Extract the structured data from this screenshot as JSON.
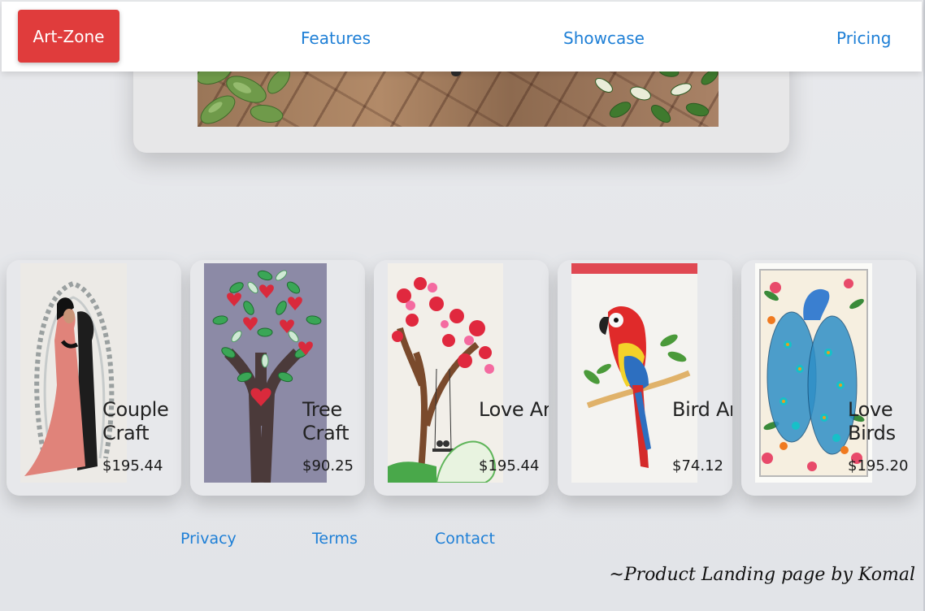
{
  "header": {
    "brand": "Art-Zone",
    "nav": [
      {
        "label": "Features"
      },
      {
        "label": "Showcase"
      },
      {
        "label": "Pricing"
      }
    ]
  },
  "products": [
    {
      "title": "Couple Craft",
      "price": "$195.44",
      "icon": "couple-quilling-art"
    },
    {
      "title": "Tree Craft",
      "price": "$90.25",
      "icon": "heart-tree-quilling-art"
    },
    {
      "title": "Love Art",
      "price": "$195.44",
      "icon": "blossom-tree-swing-art"
    },
    {
      "title": "Bird Art",
      "price": "$74.12",
      "icon": "parrot-quilling-art"
    },
    {
      "title": "Love Birds",
      "price": "$195.20",
      "icon": "peacock-quilling-art"
    }
  ],
  "footer": {
    "links": [
      {
        "label": "Privacy"
      },
      {
        "label": "Terms"
      },
      {
        "label": "Contact"
      }
    ],
    "credit": "~Product Landing page by Komal"
  },
  "colors": {
    "brand": "#e03c3c",
    "link": "#1e7fd6",
    "card": "#e7e8eb",
    "background": "#e4e6ea"
  }
}
